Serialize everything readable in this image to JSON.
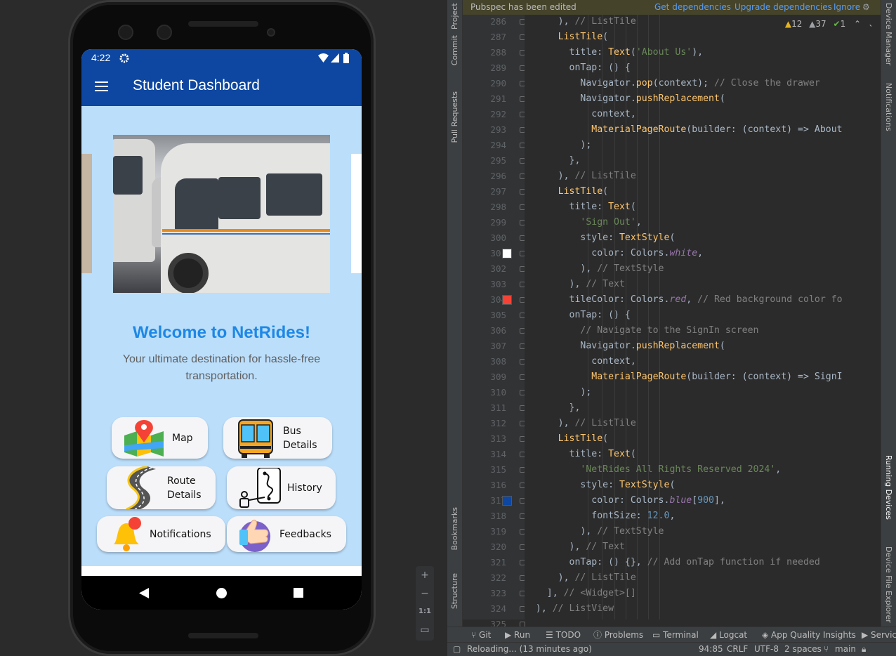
{
  "phone": {
    "status_time": "4:22",
    "app_title": "Student Dashboard",
    "welcome_title": "Welcome to NetRides!",
    "welcome_line1": "Your ultimate destination for hassle-free",
    "welcome_line2": "transportation.",
    "tiles": {
      "map": "Map",
      "bus1": "Bus",
      "bus2": "Details",
      "route1": "Route",
      "route2": "Details",
      "history": "History",
      "notifications": "Notifications",
      "feedbacks": "Feedbacks"
    },
    "accent": "#0d47a1",
    "bg": "#bbdefb",
    "welcome_color": "#1e88e5"
  },
  "emulator_controls": {
    "zoom_in": "+",
    "zoom_out": "−",
    "actual": "1:1"
  },
  "ide": {
    "left_tools": [
      "Project",
      "Commit",
      "Pull Requests",
      "Bookmarks",
      "Structure"
    ],
    "right_tools": [
      "Device Manager",
      "Notifications",
      "Running Devices",
      "Device File Explorer"
    ],
    "banner": {
      "text": "Pubspec has been edited",
      "get_deps": "Get dependencies",
      "upgrade_deps": "Upgrade dependencies",
      "ignore": "Ignore"
    },
    "inspections": {
      "warnings": "12",
      "weak_warnings": "37",
      "ok": "1"
    },
    "first_line": 286,
    "lines": [
      [
        {
          "t": "      ), "
        },
        {
          "c": "c",
          "t": "// ListTile"
        }
      ],
      [
        {
          "t": "      "
        },
        {
          "c": "f",
          "t": "ListTile"
        },
        {
          "t": "("
        }
      ],
      [
        {
          "t": "        title: "
        },
        {
          "c": "f",
          "t": "Text"
        },
        {
          "t": "("
        },
        {
          "c": "s",
          "t": "'About Us'"
        },
        {
          "t": "),"
        }
      ],
      [
        {
          "t": "        onTap: () {"
        }
      ],
      [
        {
          "t": "          Navigator."
        },
        {
          "c": "f",
          "t": "pop"
        },
        {
          "t": "(context); "
        },
        {
          "c": "c",
          "t": "// Close the drawer"
        }
      ],
      [
        {
          "t": "          Navigator."
        },
        {
          "c": "f",
          "t": "pushReplacement"
        },
        {
          "t": "("
        }
      ],
      [
        {
          "t": "            context,"
        }
      ],
      [
        {
          "t": "            "
        },
        {
          "c": "f",
          "t": "MaterialPageRoute"
        },
        {
          "t": "(builder: (context) => About"
        }
      ],
      [
        {
          "t": "          );"
        }
      ],
      [
        {
          "t": "        },"
        }
      ],
      [
        {
          "t": "      ), "
        },
        {
          "c": "c",
          "t": "// ListTile"
        }
      ],
      [
        {
          "t": "      "
        },
        {
          "c": "f",
          "t": "ListTile"
        },
        {
          "t": "("
        }
      ],
      [
        {
          "t": "        title: "
        },
        {
          "c": "f",
          "t": "Text"
        },
        {
          "t": "("
        }
      ],
      [
        {
          "t": "          "
        },
        {
          "c": "s",
          "t": "'Sign Out'"
        },
        {
          "t": ","
        }
      ],
      [
        {
          "t": "          style: "
        },
        {
          "c": "f",
          "t": "TextStyle"
        },
        {
          "t": "("
        }
      ],
      [
        {
          "t": "            color: Colors."
        },
        {
          "c": "p",
          "t": "white"
        },
        {
          "t": ","
        }
      ],
      [
        {
          "t": "          ), "
        },
        {
          "c": "c",
          "t": "// TextStyle"
        }
      ],
      [
        {
          "t": "        ), "
        },
        {
          "c": "c",
          "t": "// Text"
        }
      ],
      [
        {
          "t": "        tileColor: Colors."
        },
        {
          "c": "p",
          "t": "red"
        },
        {
          "t": ", "
        },
        {
          "c": "c",
          "t": "// Red background color fo"
        }
      ],
      [
        {
          "t": "        onTap: () {"
        }
      ],
      [
        {
          "t": "          "
        },
        {
          "c": "c",
          "t": "// Navigate to the SignIn screen"
        }
      ],
      [
        {
          "t": "          Navigator."
        },
        {
          "c": "f",
          "t": "pushReplacement"
        },
        {
          "t": "("
        }
      ],
      [
        {
          "t": "            context,"
        }
      ],
      [
        {
          "t": "            "
        },
        {
          "c": "f",
          "t": "MaterialPageRoute"
        },
        {
          "t": "(builder: (context) => SignI"
        }
      ],
      [
        {
          "t": "          );"
        }
      ],
      [
        {
          "t": "        },"
        }
      ],
      [
        {
          "t": "      ), "
        },
        {
          "c": "c",
          "t": "// ListTile"
        }
      ],
      [
        {
          "t": "      "
        },
        {
          "c": "f",
          "t": "ListTile"
        },
        {
          "t": "("
        }
      ],
      [
        {
          "t": "        title: "
        },
        {
          "c": "f",
          "t": "Text"
        },
        {
          "t": "("
        }
      ],
      [
        {
          "t": "          "
        },
        {
          "c": "s",
          "t": "'NetRides All Rights Reserved 2024'"
        },
        {
          "t": ","
        }
      ],
      [
        {
          "t": "          style: "
        },
        {
          "c": "f",
          "t": "TextStyle"
        },
        {
          "t": "("
        }
      ],
      [
        {
          "t": "            color: Colors."
        },
        {
          "c": "p",
          "t": "blue"
        },
        {
          "t": "["
        },
        {
          "c": "n",
          "t": "900"
        },
        {
          "t": "],"
        }
      ],
      [
        {
          "t": "            fontSize: "
        },
        {
          "c": "n",
          "t": "12.0"
        },
        {
          "t": ","
        }
      ],
      [
        {
          "t": "          ), "
        },
        {
          "c": "c",
          "t": "// TextStyle"
        }
      ],
      [
        {
          "t": "        ), "
        },
        {
          "c": "c",
          "t": "// Text"
        }
      ],
      [
        {
          "t": "        onTap: () {}, "
        },
        {
          "c": "c",
          "t": "// Add onTap function if needed"
        }
      ],
      [
        {
          "t": "      ), "
        },
        {
          "c": "c",
          "t": "// ListTile"
        }
      ],
      [
        {
          "t": "    ], "
        },
        {
          "c": "c",
          "t": "// <Widget>[]"
        }
      ],
      [
        {
          "t": "  ), "
        },
        {
          "c": "c",
          "t": "// ListView"
        }
      ],
      [
        {
          "t": "), "
        },
        {
          "c": "c",
          "t": "// Drawer"
        }
      ]
    ],
    "swatches": [
      {
        "line": 301,
        "color": "#ffffff"
      },
      {
        "line": 304,
        "color": "#f44336"
      },
      {
        "line": 317,
        "color": "#0d47a1"
      }
    ],
    "tool_tabs": [
      "Git",
      "Run",
      "TODO",
      "Problems",
      "Terminal",
      "Logcat",
      "App Quality Insights",
      "Servic"
    ],
    "status": {
      "message": "Reloading... (13 minutes ago)",
      "position": "94:85",
      "line_sep": "CRLF",
      "encoding": "UTF-8",
      "indent": "2 spaces",
      "branch": "main"
    }
  }
}
